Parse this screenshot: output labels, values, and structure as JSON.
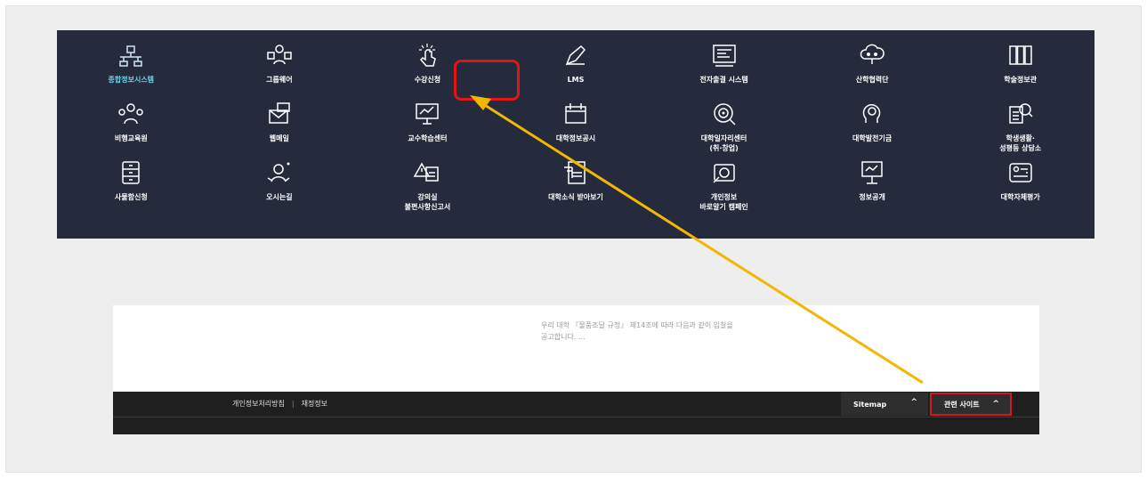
{
  "panel": {
    "items": [
      {
        "label": "종합정보시스템",
        "icon": "org-chart-icon",
        "active": true
      },
      {
        "label": "그룹웨어",
        "icon": "group-icon"
      },
      {
        "label": "수강신청",
        "icon": "touch-hand-icon"
      },
      {
        "label": "LMS",
        "icon": "pen-icon"
      },
      {
        "label": "전자출결 시스템",
        "icon": "attendance-board-icon"
      },
      {
        "label": "산학협력단",
        "icon": "cloud-network-icon"
      },
      {
        "label": "학술정보관",
        "icon": "library-books-icon"
      },
      {
        "label": "비행교육원",
        "icon": "team-icon"
      },
      {
        "label": "웹메일",
        "icon": "mail-icon"
      },
      {
        "label": "교수학습센터",
        "icon": "presentation-icon"
      },
      {
        "label": "대학정보공시",
        "icon": "calendar-icon"
      },
      {
        "label": "대학일자리센터\n(취·창업)",
        "icon": "target-icon"
      },
      {
        "label": "대학발전기금",
        "icon": "fund-head-icon"
      },
      {
        "label": "학생생활·\n성평등 상담소",
        "icon": "document-search-icon"
      },
      {
        "label": "사물함신청",
        "icon": "locker-icon"
      },
      {
        "label": "오시는길",
        "icon": "map-person-icon"
      },
      {
        "label": "강의실\n불편사항신고서",
        "icon": "warning-report-icon"
      },
      {
        "label": "대학소식 받아보기",
        "icon": "newsletter-icon"
      },
      {
        "label": "개인정보\n바로알기 캠페인",
        "icon": "privacy-camera-icon"
      },
      {
        "label": "정보공개",
        "icon": "info-board-icon"
      },
      {
        "label": "대학자체평가",
        "icon": "evaluation-icon"
      }
    ]
  },
  "bottom": {
    "notice_text": "우리 대학 『물품조달 규정』 제14조에 따라 다음과 같이 입찰을 공고합니다. ...",
    "footer": {
      "privacy_policy": "개인정보처리방침",
      "separator": "|",
      "financial_info": "재정정보",
      "sitemap": "Sitemap",
      "related_sites": "관련 사이트",
      "caret": "^"
    }
  },
  "colors": {
    "panel_bg": "#252a3d",
    "active_label": "#6fd0ea",
    "highlight": "#e0151b",
    "arrow": "#f2b705",
    "footer_bg": "#1f1f1f"
  }
}
